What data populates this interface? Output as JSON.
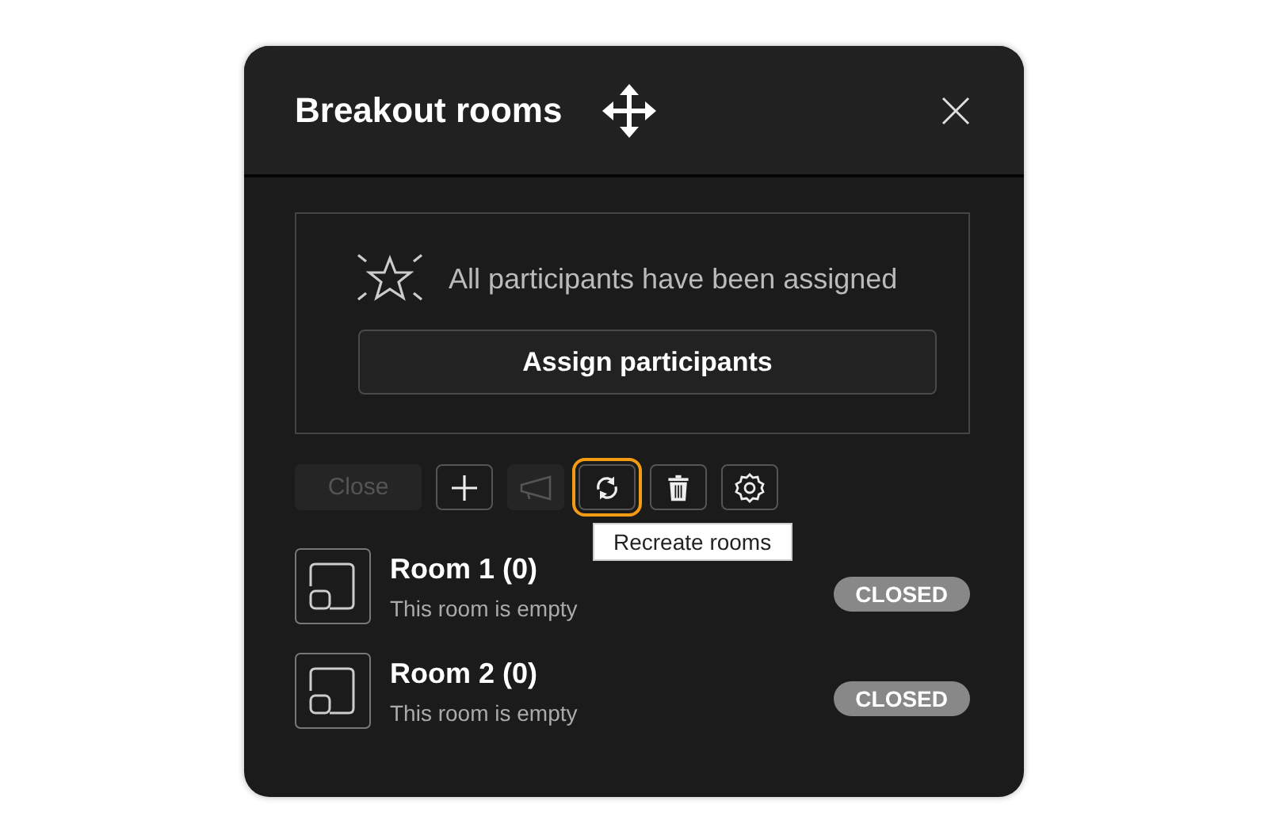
{
  "dialog": {
    "title": "Breakout rooms"
  },
  "status": {
    "message": "All participants have been assigned",
    "button": "Assign participants"
  },
  "toolbar": [
    {
      "kind": "close",
      "label": "Close",
      "disabled": true,
      "focused": false
    },
    {
      "kind": "add",
      "disabled": false,
      "focused": false
    },
    {
      "kind": "announce",
      "disabled": true,
      "focused": false
    },
    {
      "kind": "recreate",
      "disabled": false,
      "focused": true,
      "tooltip": "Recreate rooms"
    },
    {
      "kind": "delete",
      "disabled": false,
      "focused": false
    },
    {
      "kind": "settings",
      "disabled": false,
      "focused": false
    }
  ],
  "rooms": [
    {
      "name": "Room 1 (0)",
      "subtitle": "This room is empty",
      "status": "CLOSED"
    },
    {
      "name": "Room 2 (0)",
      "subtitle": "This room is empty",
      "status": "CLOSED"
    }
  ]
}
